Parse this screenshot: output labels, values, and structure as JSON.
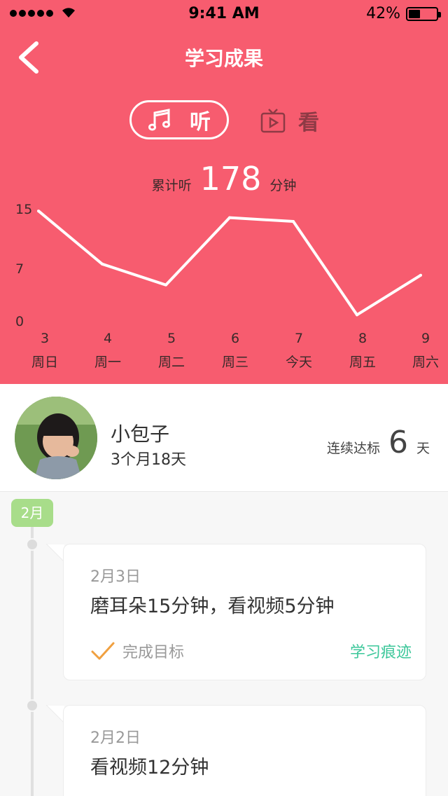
{
  "status_bar": {
    "time": "9:41 AM",
    "battery": "42%",
    "battery_level": 0.42
  },
  "header": {
    "title": "学习成果"
  },
  "tabs": [
    {
      "label": "听",
      "icon": "music-note-icon",
      "active": true
    },
    {
      "label": "看",
      "icon": "tv-icon",
      "active": false
    }
  ],
  "summary": {
    "prefix": "累计听",
    "total": "178",
    "unit": "分钟"
  },
  "chart_data": {
    "type": "line",
    "categories": [
      "3",
      "4",
      "5",
      "6",
      "7",
      "8",
      "9"
    ],
    "category_labels": [
      "周日",
      "周一",
      "周二",
      "周三",
      "今天",
      "周五",
      "周六"
    ],
    "values": [
      14.9,
      7.8,
      5.0,
      14.0,
      13.5,
      1.0,
      6.3
    ],
    "y_ticks": [
      "15",
      "7",
      "0"
    ],
    "ylim": [
      0,
      15
    ],
    "color": "#ffffff"
  },
  "profile": {
    "name": "小包子",
    "age": "3个月18天",
    "streak_label": "连续达标",
    "streak_days": "6",
    "streak_unit": "天"
  },
  "timeline": {
    "month": "2月",
    "records": [
      {
        "date": "2月3日",
        "text": "磨耳朵15分钟，看视频5分钟",
        "status": "完成目标",
        "link": "学习痕迹"
      },
      {
        "date": "2月2日",
        "text": "看视频12分钟"
      }
    ]
  },
  "colors": {
    "header_bg": "#f75c6f",
    "accent_green": "#3cc79a",
    "month_badge": "#a8dd8a",
    "check": "#f0a040"
  }
}
